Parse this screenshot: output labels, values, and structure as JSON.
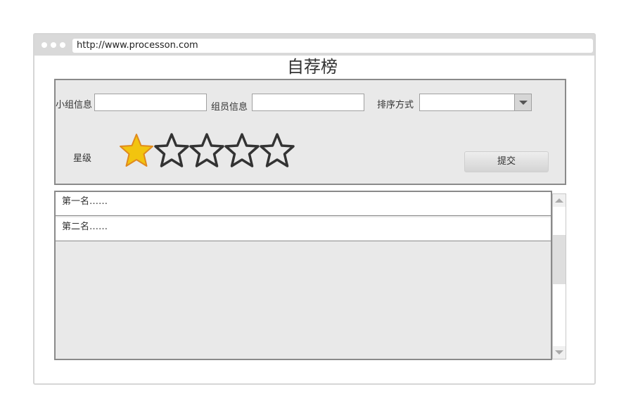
{
  "browser": {
    "url": "http://www.processon.com"
  },
  "page": {
    "title": "自荐榜"
  },
  "form": {
    "group_label": "小组信息",
    "group_value": "",
    "member_label": "组员信息",
    "member_value": "",
    "sort_label": "排序方式",
    "sort_value": "",
    "rating_label": "星级",
    "rating": {
      "value": 1,
      "max": 5
    },
    "submit_label": "提交"
  },
  "colors": {
    "star_filled": "#f2c40f",
    "star_outline": "#333333",
    "panel_bg": "#e9e9e9"
  },
  "list": {
    "items": [
      {
        "text": "第一名……"
      },
      {
        "text": "第二名……"
      }
    ]
  }
}
